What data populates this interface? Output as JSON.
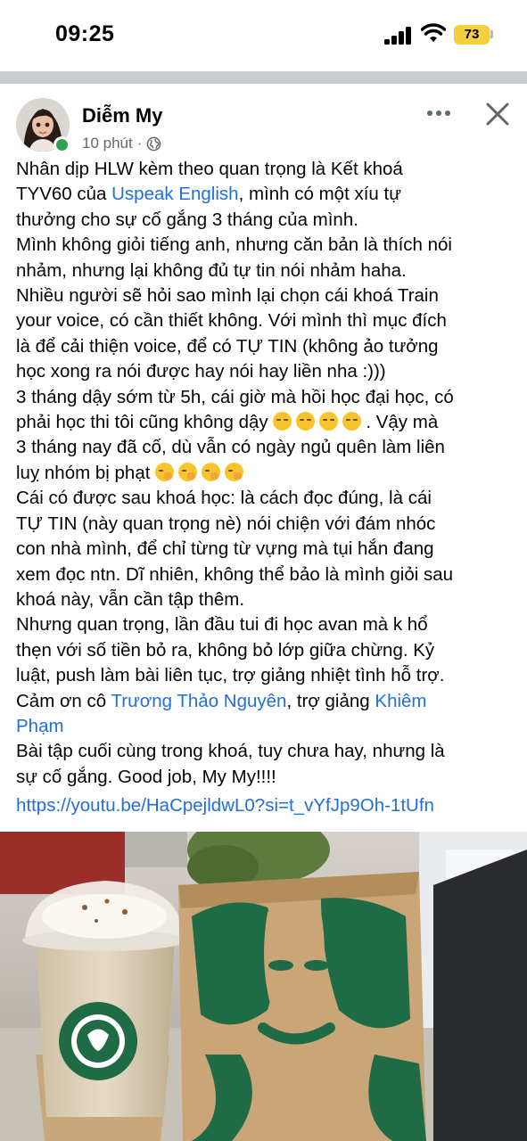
{
  "status_bar": {
    "time": "09:25",
    "battery": "73",
    "icons": [
      "signal-icon",
      "wifi-icon",
      "battery-icon"
    ]
  },
  "post": {
    "author": "Diễm My",
    "time_ago": "10 phút",
    "separator": "·",
    "privacy_icon": "globe-icon",
    "lines": {
      "l1": "Nhân dịp HLW kèm theo quan trọng là Kết khoá",
      "l2a": "TYV60 của ",
      "l2b": "Uspeak English",
      "l2c": ", mình có một xíu tự",
      "l3": "thưởng cho sự cố gắng 3 tháng của mình.",
      "l4": "Mình không giỏi tiếng anh, nhưng căn bản là thích nói",
      "l5": "nhảm, nhưng lại không đủ tự tin nói nhảm haha.",
      "l6": "Nhiều người sẽ hỏi sao mình lại chọn cái khoá Train",
      "l7": "your voice, có cần thiết không. Với mình thì mục đích",
      "l8": "là để cải thiện voice, để có TỰ TIN (không ảo tưởng",
      "l9": "học xong ra nói được hay nói hay liền nha :)))",
      "l10": "3 tháng dậy sớm từ 5h, cái giờ mà hồi học đại học, có",
      "l11a": "phải học thi tôi cũng không dậy ",
      "l11b": ". Vậy mà",
      "l12": "3 tháng nay đã cố, dù vẫn có ngày ngủ quên làm liên",
      "l13": "luỵ nhóm bị phạt ",
      "l14": "Cái có được sau khoá học: là cách đọc đúng, là cái",
      "l15": "TỰ TIN (này quan trọng nè) nói chiện với đám nhóc",
      "l16": "con nhà mình, để chỉ từng từ vựng mà tụi hắn đang",
      "l17": "xem đọc ntn. Dĩ nhiên, không thể bảo là mình giỏi sau",
      "l18": "khoá này, vẫn cần tập thêm.",
      "l19": "Nhưng quan trọng, lần đầu tui đi học avan mà k hổ",
      "l20": "thẹn với số tiền bỏ ra, không bỏ lớp giữa chừng. Kỷ",
      "l21": "luật, push làm bài liên tục, trợ giảng nhiệt tình hỗ trợ.",
      "l22a": "Cảm ơn cô ",
      "l22b": "Trương Thảo Nguyên",
      "l22c": ", trợ giảng ",
      "l22d": "Khiêm",
      "l23": "Phạm",
      "l24": "Bài tập cuối cùng trong khoá, tuy chưa hay, nhưng là",
      "l25": "sự cố gắng. Good job, My My!!!!"
    },
    "url": "https://youtu.be/HaCpejldwL0?si=t_vYfJp9Oh-1tUfn",
    "photo": "Starbucks drink and paper bag on a desk"
  },
  "colors": {
    "link": "#216fdb",
    "online": "#31a24c",
    "battery": "#f4d03f",
    "starbucks_green": "#1e6b45"
  }
}
